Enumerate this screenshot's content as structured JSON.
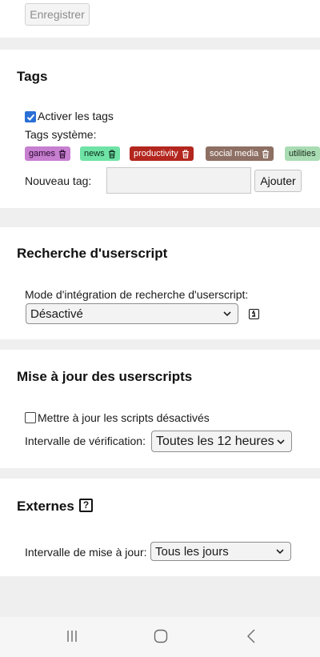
{
  "top": {
    "save_label": "Enregistrer"
  },
  "tags": {
    "heading": "Tags",
    "enable_label": "Activer les tags",
    "system_label": "Tags système:",
    "items": [
      {
        "label": "games",
        "bg": "#c77fd0",
        "fg": "#2a0a30"
      },
      {
        "label": "news",
        "bg": "#6fe3a6",
        "fg": "#0c2a1a"
      },
      {
        "label": "productivity",
        "bg": "#b3261e",
        "fg": "#ffffff"
      },
      {
        "label": "social media",
        "bg": "#8e6f63",
        "fg": "#ffffff"
      },
      {
        "label": "utilities",
        "bg": "#a9dcb3",
        "fg": "#1a2a1c"
      }
    ],
    "new_tag_label": "Nouveau tag:",
    "new_tag_value": "",
    "add_label": "Ajouter"
  },
  "search": {
    "heading": "Recherche d'userscript",
    "mode_label": "Mode d'intégration de recherche d'userscript:",
    "mode_value": "Désactivé"
  },
  "updates": {
    "heading": "Mise à jour des userscripts",
    "update_disabled_label": "Mettre à jour les scripts désactivés",
    "interval_label": "Intervalle de vérification:",
    "interval_value": "Toutes les 12 heures"
  },
  "externals": {
    "heading": "Externes",
    "help_glyph": "?",
    "interval_label": "Intervalle de mise à jour:",
    "interval_value": "Tous les jours"
  },
  "colors": {
    "checkbox_accent": "#2a6fd6",
    "page_background": "#efefef"
  }
}
